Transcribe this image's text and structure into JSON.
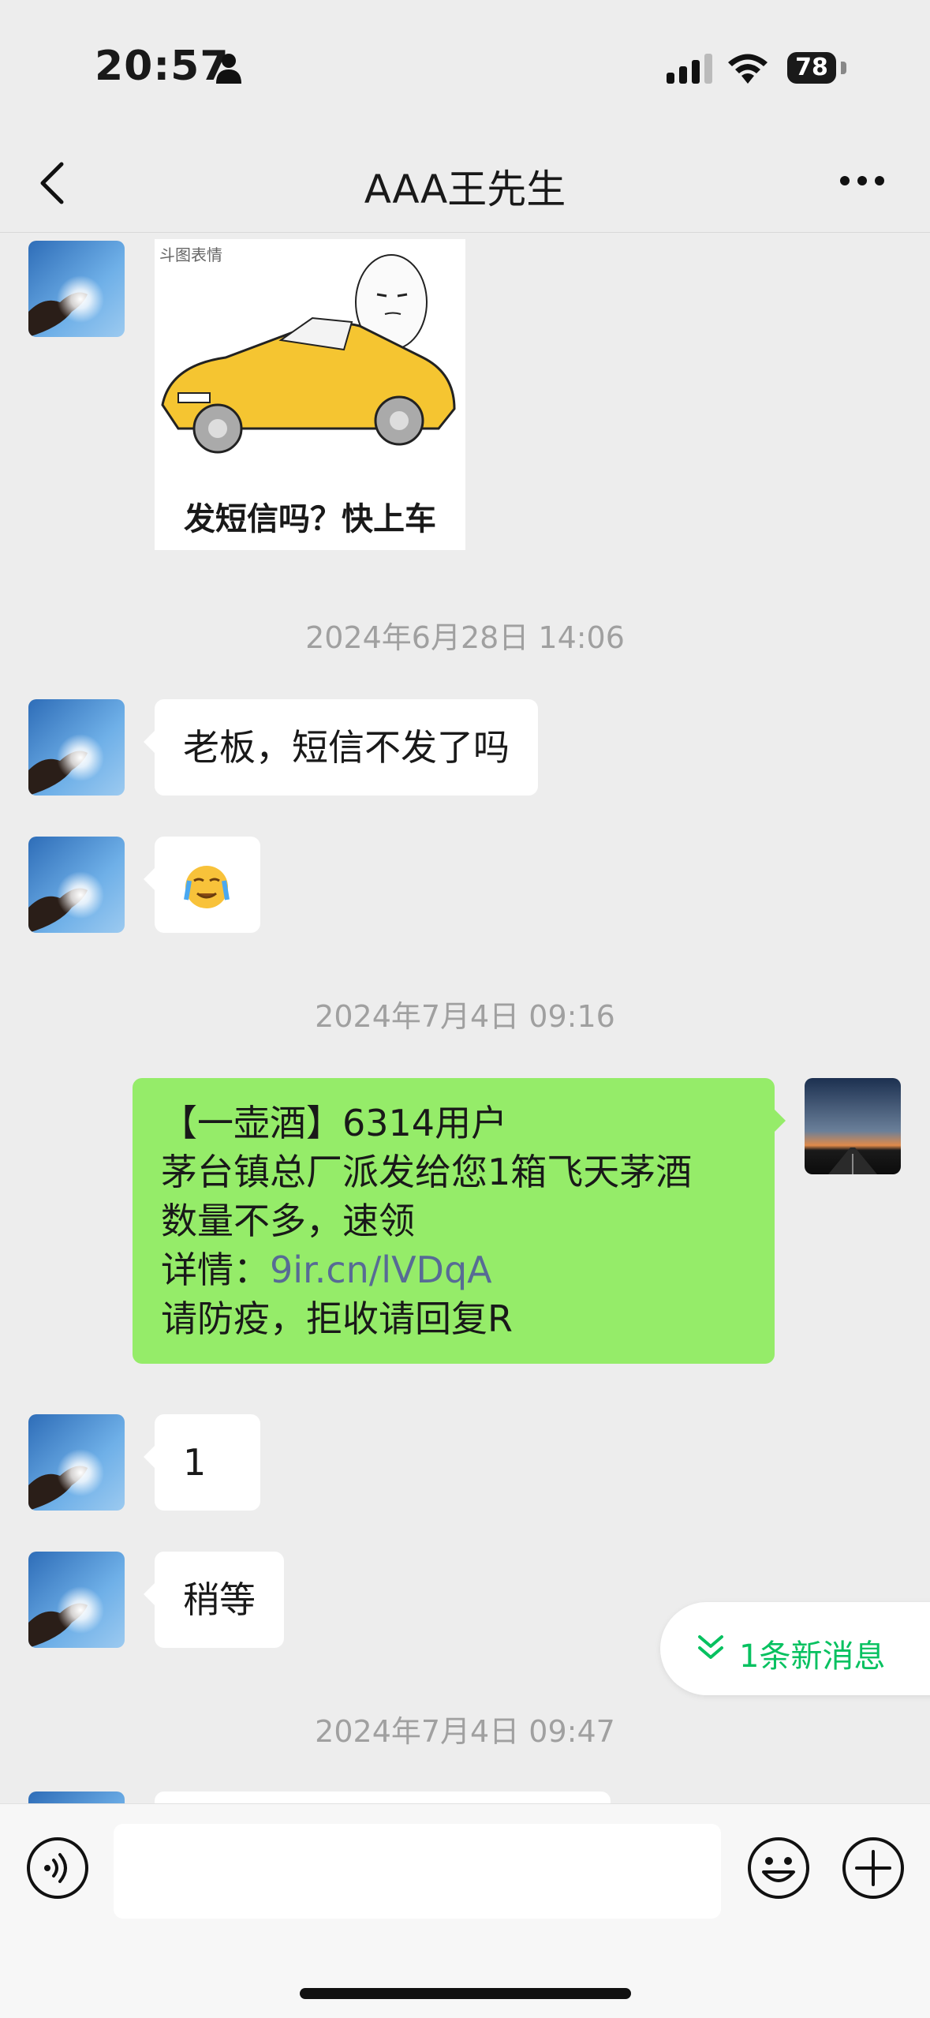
{
  "status_bar": {
    "time": "20:57",
    "battery": "78"
  },
  "nav": {
    "title": "AAA王先生"
  },
  "chat": {
    "sticker_brand": "斗图表情",
    "sticker_caption": "发短信吗？快上车",
    "timestamp_1": "2024年6月28日 14:06",
    "msg_1": "老板，短信不发了吗",
    "msg_2_emoji": "😭",
    "timestamp_2": "2024年7月4日 09:16",
    "sms_line_1": "【一壶酒】6314用户",
    "sms_line_2": "茅台镇总厂派发给您1箱飞天茅酒",
    "sms_line_3": "数量不多，速领",
    "sms_line_4_prefix": "详情：",
    "sms_line_4_link": "9ir.cn/lVDqA",
    "sms_line_5": "请防疫，拒收请回复R",
    "msg_3": "1",
    "msg_4": "稍等",
    "timestamp_3": "2024年7月4日 09:47",
    "new_messages": "1条新消息"
  },
  "input": {
    "placeholder": ""
  },
  "colors": {
    "accent": "#07c160",
    "sent_bubble": "#95ec69",
    "background": "#ededed",
    "link": "#576b95"
  }
}
